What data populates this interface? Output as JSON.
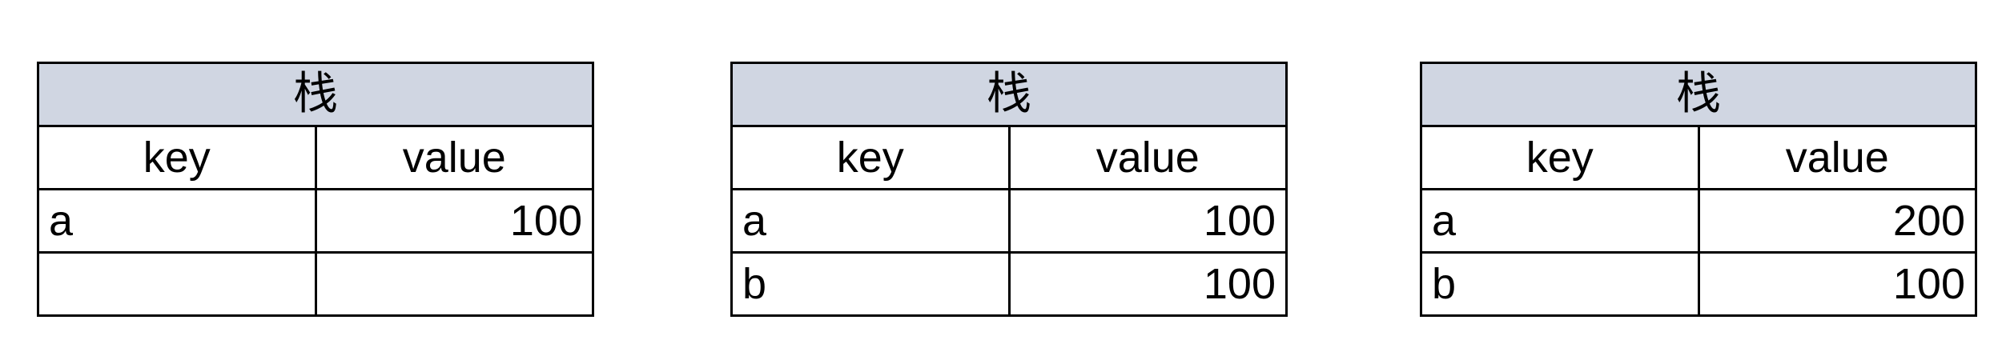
{
  "tables": [
    {
      "title": "栈",
      "headers": {
        "key": "key",
        "value": "value"
      },
      "rows": [
        {
          "key": "a",
          "value": "100"
        },
        {
          "key": "",
          "value": ""
        }
      ]
    },
    {
      "title": "栈",
      "headers": {
        "key": "key",
        "value": "value"
      },
      "rows": [
        {
          "key": "a",
          "value": "100"
        },
        {
          "key": "b",
          "value": "100"
        }
      ]
    },
    {
      "title": "栈",
      "headers": {
        "key": "key",
        "value": "value"
      },
      "rows": [
        {
          "key": "a",
          "value": "200"
        },
        {
          "key": "b",
          "value": "100"
        }
      ]
    }
  ],
  "colors": {
    "title_background": "#d0d6e2",
    "border": "#000000"
  }
}
